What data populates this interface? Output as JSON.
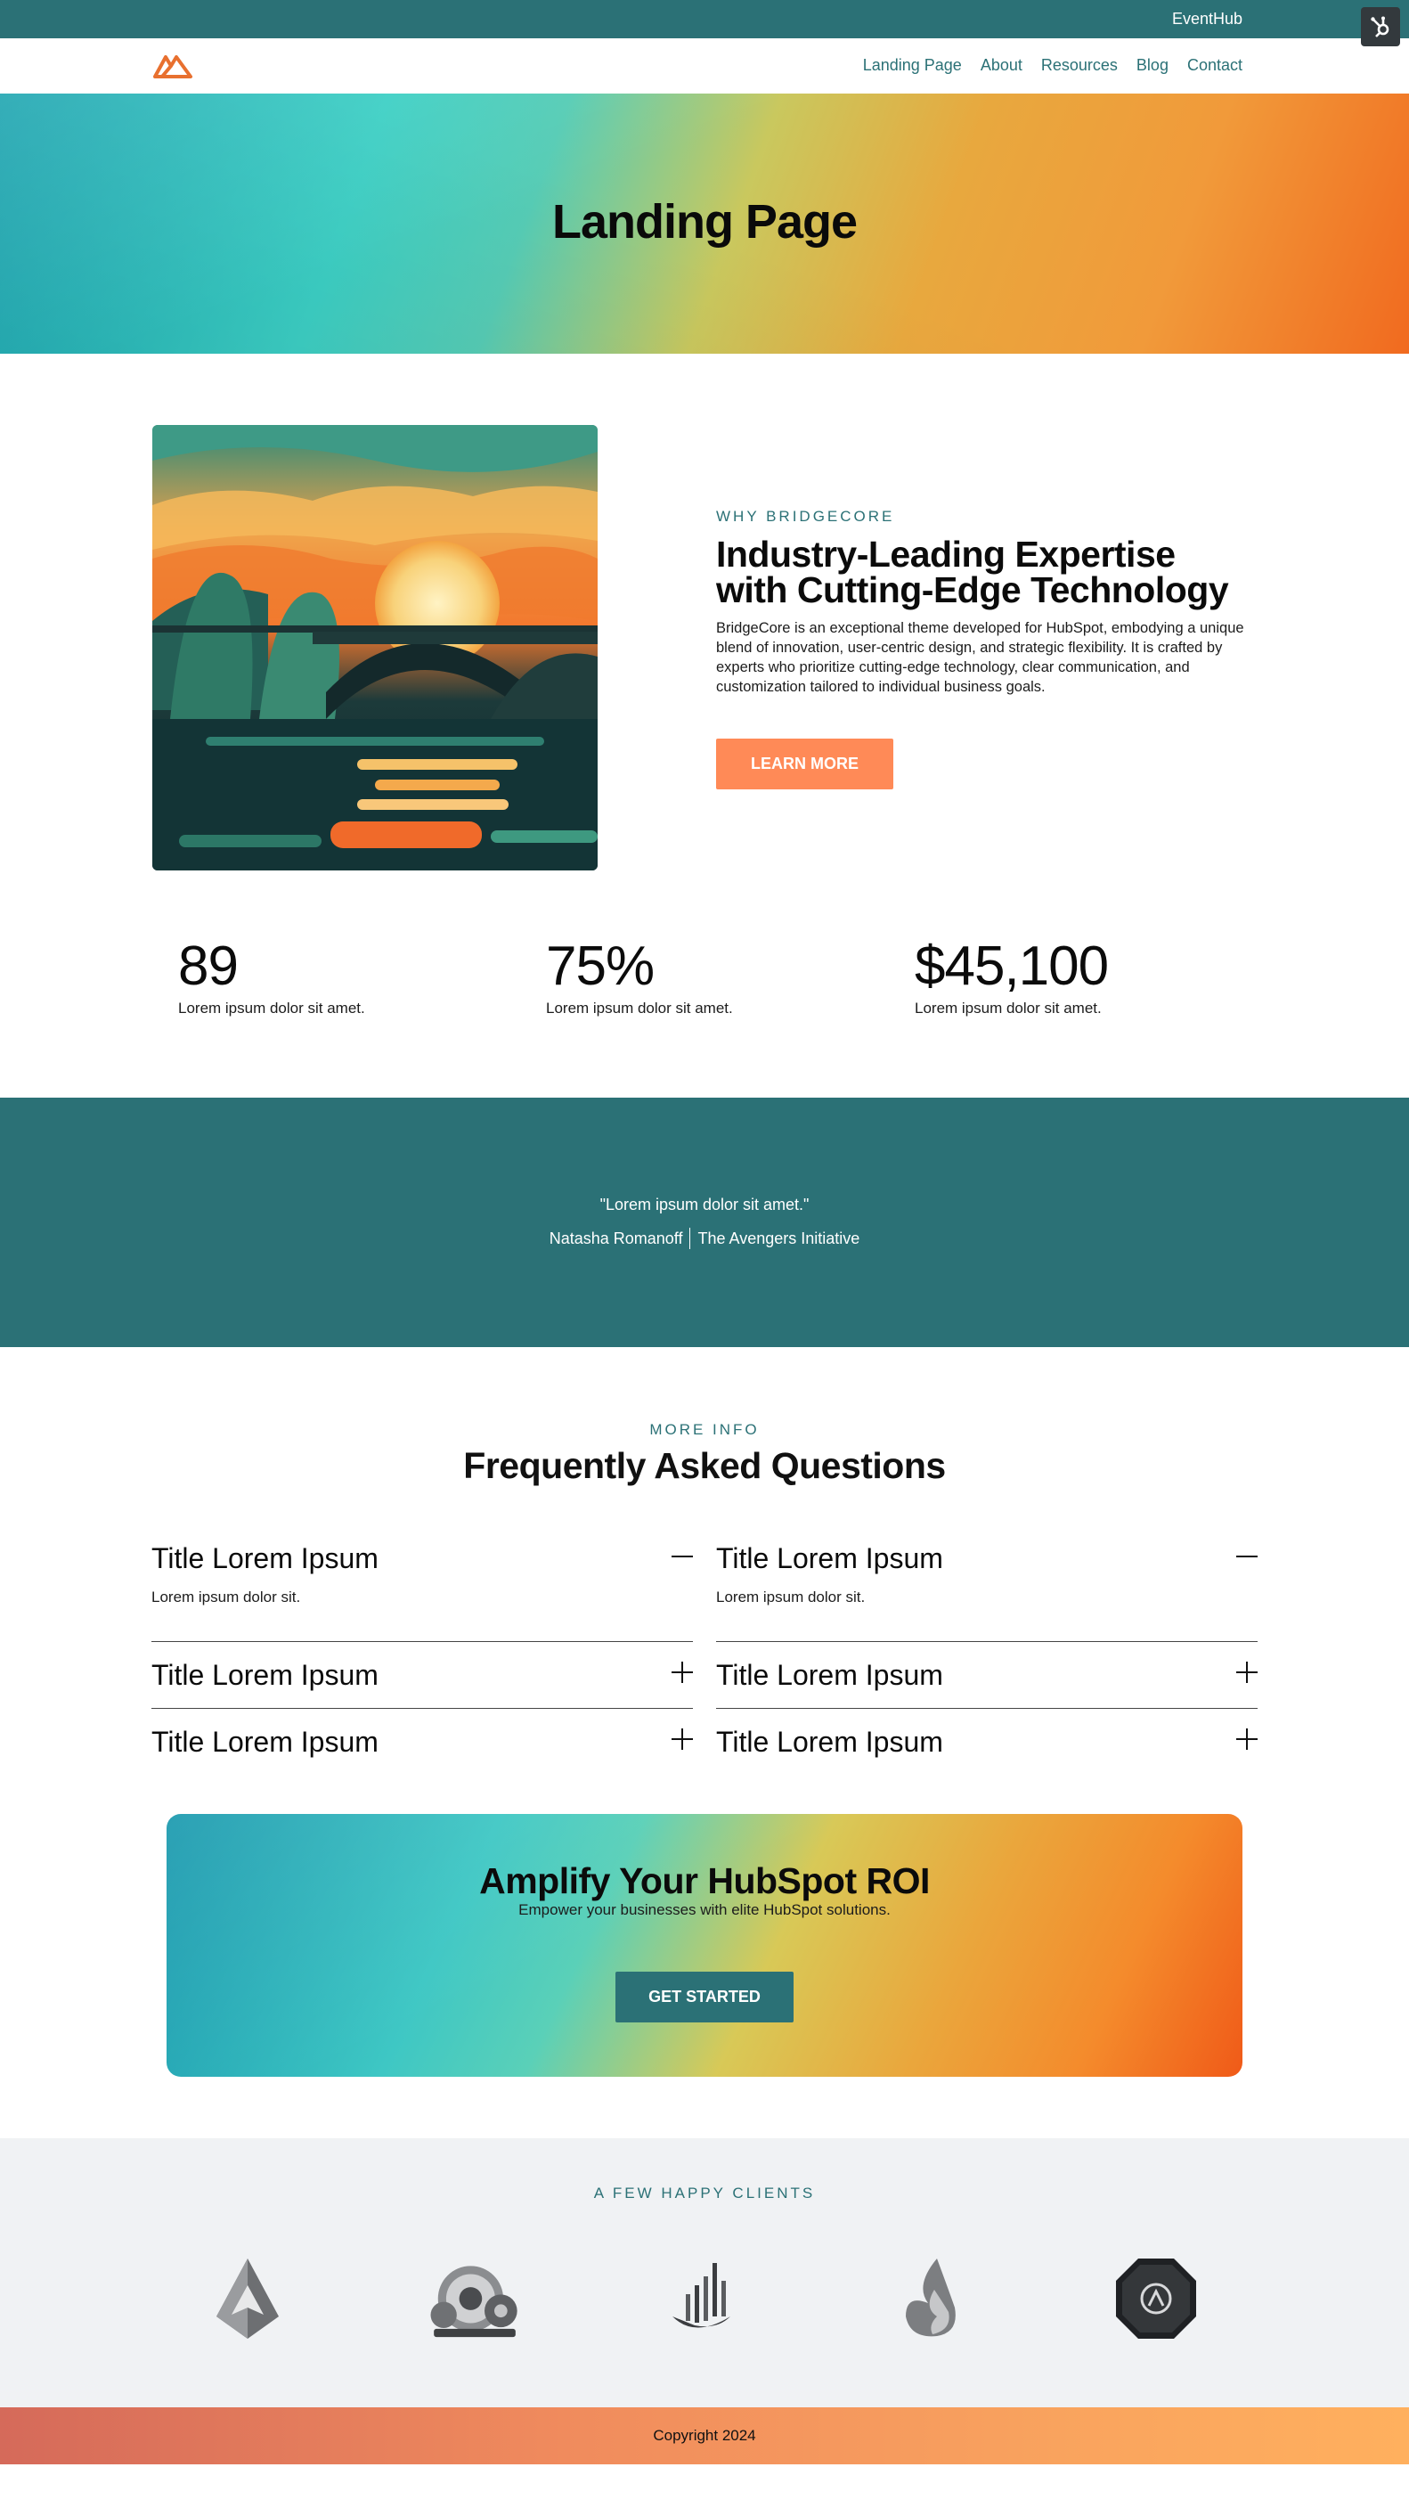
{
  "topbar": {
    "brand": "EventHub"
  },
  "nav": {
    "items": [
      "Landing Page",
      "About",
      "Resources",
      "Blog",
      "Contact"
    ]
  },
  "hero": {
    "title": "Landing Page"
  },
  "feature": {
    "eyebrow": "WHY BRIDGECORE",
    "heading": "Industry-Leading Expertise with Cutting-Edge Technology",
    "body": "BridgeCore is an exceptional theme developed for HubSpot, embodying a unique blend of innovation, user-centric design, and strategic flexibility. It is crafted by experts who prioritize cutting-edge technology, clear communication, and customization tailored to individual business goals.",
    "button": "LEARN MORE"
  },
  "stats": [
    {
      "value": "89",
      "label": "Lorem ipsum dolor sit amet."
    },
    {
      "value": "75%",
      "label": "Lorem ipsum dolor sit amet."
    },
    {
      "value": "$45,100",
      "label": "Lorem ipsum dolor sit amet."
    }
  ],
  "testimonial": {
    "quote": "\"Lorem ipsum dolor sit amet.\"",
    "name": "Natasha Romanoff",
    "company": "The Avengers Initiative"
  },
  "faq": {
    "eyebrow": "MORE INFO",
    "title": "Frequently Asked Questions",
    "left": [
      {
        "q": "Title Lorem Ipsum",
        "a": "Lorem ipsum dolor sit.",
        "open": true
      },
      {
        "q": "Title Lorem Ipsum",
        "a": "",
        "open": false
      },
      {
        "q": "Title Lorem Ipsum",
        "a": "",
        "open": false
      }
    ],
    "right": [
      {
        "q": "Title Lorem Ipsum",
        "a": "Lorem ipsum dolor sit.",
        "open": true
      },
      {
        "q": "Title Lorem Ipsum",
        "a": "",
        "open": false
      },
      {
        "q": "Title Lorem Ipsum",
        "a": "",
        "open": false
      }
    ]
  },
  "cta": {
    "title": "Amplify Your HubSpot ROI",
    "subtitle": "Empower your businesses with elite HubSpot solutions.",
    "button": "GET STARTED"
  },
  "clients": {
    "eyebrow": "A FEW HAPPY CLIENTS"
  },
  "footer": {
    "copyright": "Copyright 2024"
  },
  "colors": {
    "teal": "#2b7176",
    "orange": "#ff8a57",
    "logo_orange": "#e8702f",
    "light_bg": "#f0f2f4"
  }
}
